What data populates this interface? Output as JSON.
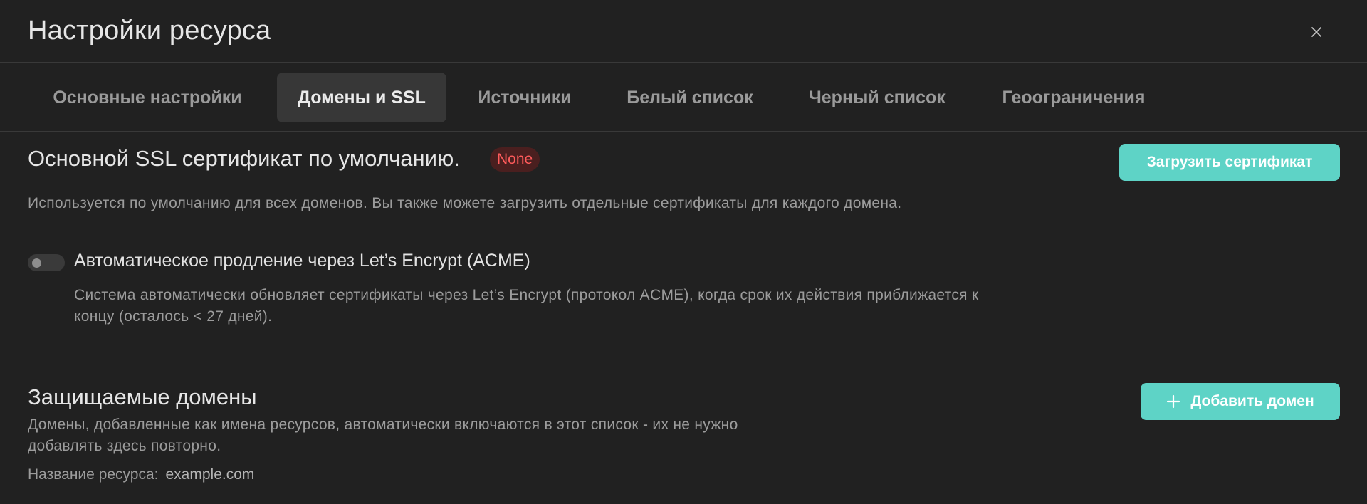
{
  "dialog": {
    "title": "Настройки ресурса",
    "close_icon": "close-icon"
  },
  "tabs": [
    {
      "label": "Основные настройки",
      "active": false
    },
    {
      "label": "Домены и SSL",
      "active": true
    },
    {
      "label": "Источники",
      "active": false
    },
    {
      "label": "Белый список",
      "active": false
    },
    {
      "label": "Черный список",
      "active": false
    },
    {
      "label": "Геоограничения",
      "active": false
    }
  ],
  "ssl": {
    "title": "Основной SSL сертификат по умолчанию.",
    "status_badge": "None",
    "upload_button": "Загрузить сертификат",
    "description": "Используется по умолчанию для всех доменов. Вы также можете загрузить отдельные сертификаты для каждого домена.",
    "acme_toggle": {
      "label": "Автоматическое продление через Let’s Encrypt (ACME)",
      "enabled": false,
      "description_line1": "Система автоматически обновляет сертификаты через Let’s Encrypt (протокол ACME), когда срок их действия приближается к",
      "description_line2": "концу (осталось < 27 дней)."
    }
  },
  "domains": {
    "title": "Защищаемые домены",
    "add_button": "Добавить домен",
    "add_icon": "plus-icon",
    "description_line1": "Домены, добавленные как имена ресурсов, автоматически включаются в этот список - их не нужно",
    "description_line2": "добавлять здесь повторно.",
    "resource_label": "Название ресурса:",
    "resource_value": "example.com"
  },
  "colors": {
    "background": "#212121",
    "accent": "#5ed3c6",
    "active_tab_bg": "#373737",
    "badge_text": "#ff5b5b",
    "badge_bg": "#4a1f1f"
  }
}
